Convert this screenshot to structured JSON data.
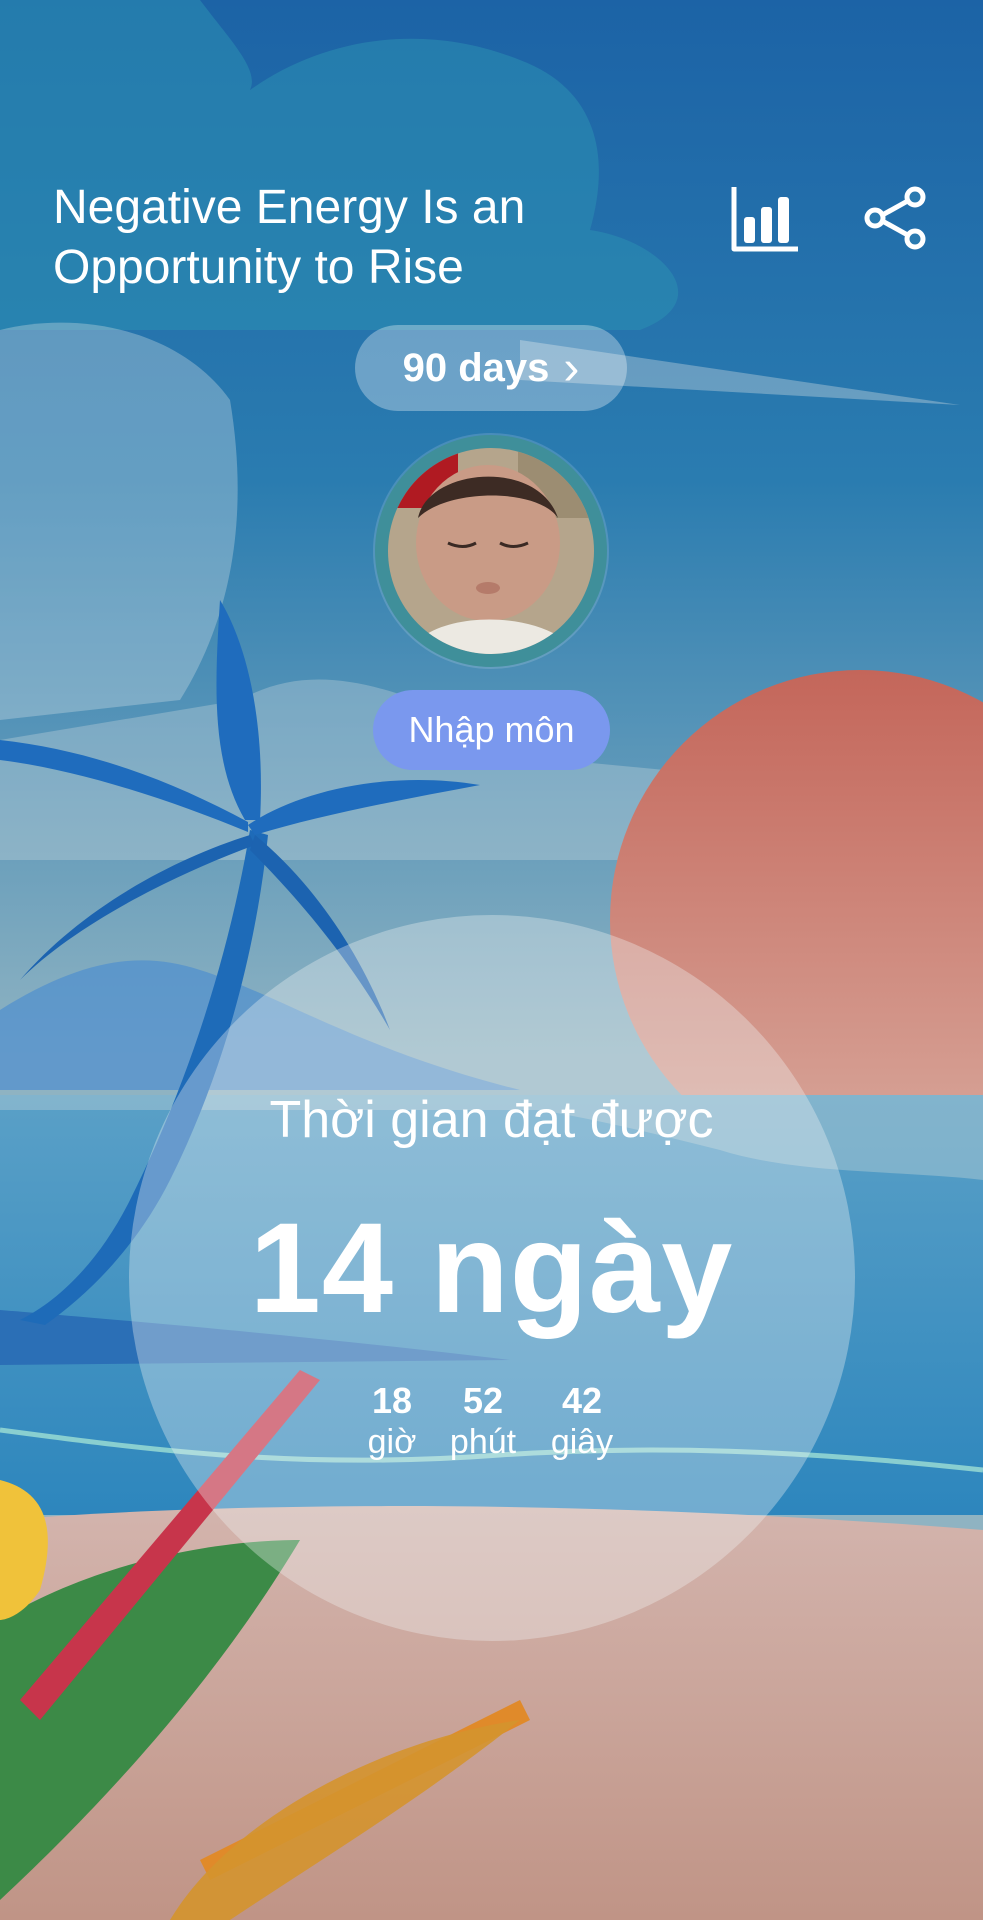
{
  "header": {
    "title": "Negative Energy Is an Opportunity to Rise",
    "stats_icon": "bar-chart-icon",
    "share_icon": "share-icon"
  },
  "goal": {
    "label": "90 days",
    "chevron": "›"
  },
  "profile": {
    "avatar": "avatar-photo"
  },
  "level": {
    "label": "Nhập môn"
  },
  "achieved": {
    "label": "Thời gian đạt được",
    "days_text": "14 ngày",
    "hours": "18",
    "hours_label": "giờ",
    "minutes": "52",
    "minutes_label": "phút",
    "seconds": "42",
    "seconds_label": "giây"
  },
  "colors": {
    "sky_top": "#1c63a6",
    "sky_bottom": "#8fb3c2",
    "sun": "#c86a5a",
    "palm": "#1e6bb8",
    "level_pill": "#7a98ee",
    "sand": "#c9a196"
  }
}
